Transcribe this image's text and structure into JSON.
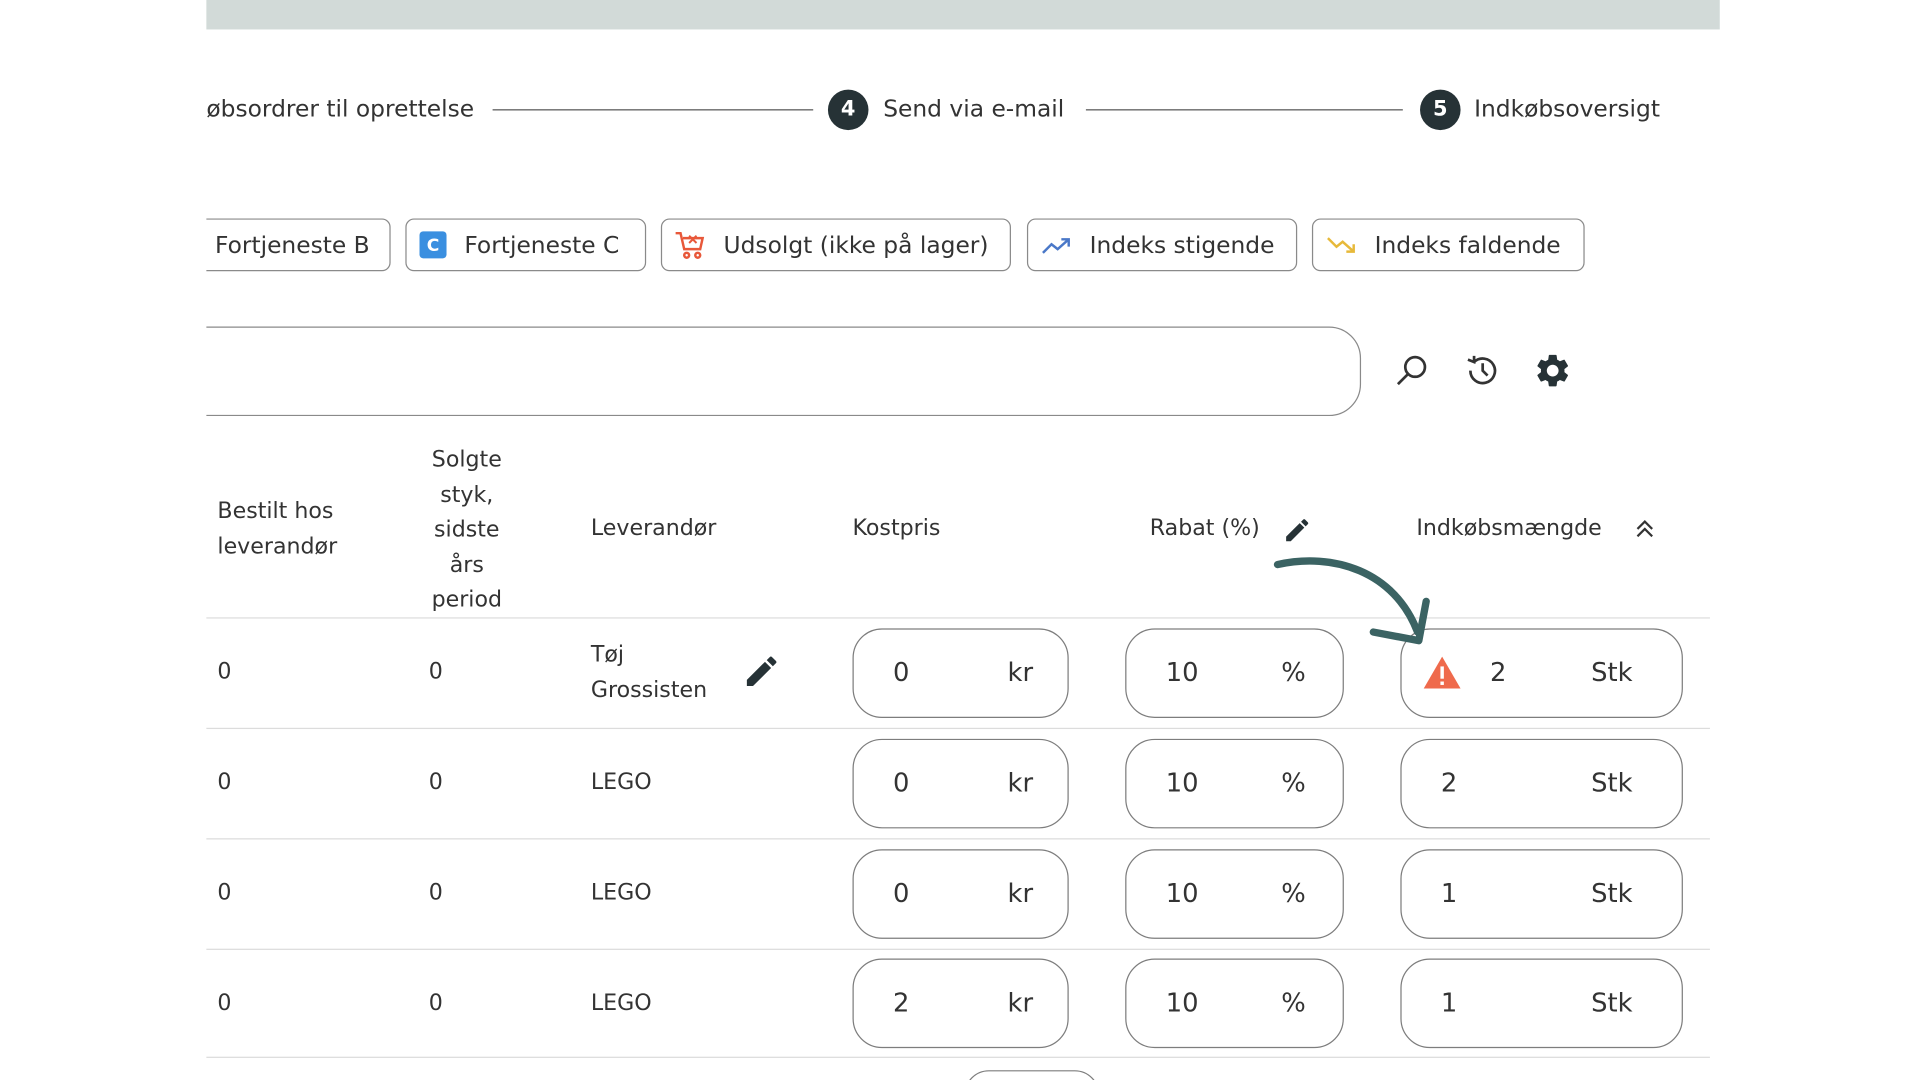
{
  "stepper": {
    "step3_label": "øbsordrer til oprettelse",
    "step4_number": "4",
    "step4_label": "Send via e-mail",
    "step5_number": "5",
    "step5_label": "Indkøbsoversigt"
  },
  "filters": {
    "chips": [
      {
        "label": "Fortjeneste B",
        "icon": "profit-b-icon"
      },
      {
        "label": "Fortjeneste C",
        "icon": "profit-c-icon",
        "badge": "C",
        "color": "#3a8fe0"
      },
      {
        "label": "Udsolgt (ikke på lager)",
        "icon": "cart-icon",
        "color": "#e8583a"
      },
      {
        "label": "Indeks stigende",
        "icon": "trend-up-icon",
        "color": "#4a78c8"
      },
      {
        "label": "Indeks faldende",
        "icon": "trend-down-icon",
        "color": "#e7b93a"
      }
    ]
  },
  "search": {
    "value": "",
    "icons": [
      "search-icon",
      "history-icon",
      "gear-icon"
    ]
  },
  "table": {
    "columns": {
      "ordered": [
        "Bestilt hos",
        "leverandør"
      ],
      "sold": [
        "Solgte",
        "styk,",
        "sidste",
        "års",
        "period"
      ],
      "supplier": "Leverandør",
      "cost": "Kostpris",
      "discount": "Rabat (%)",
      "quantity": "Indkøbsmængde"
    },
    "rows": [
      {
        "ordered": "0",
        "sold": "0",
        "supplier": [
          "Tøj",
          "Grossisten"
        ],
        "cost": "0",
        "cost_unit": "kr",
        "discount": "10",
        "discount_unit": "%",
        "quantity": "2",
        "quantity_unit": "Stk",
        "warning": true
      },
      {
        "ordered": "0",
        "sold": "0",
        "supplier": [
          "LEGO"
        ],
        "cost": "0",
        "cost_unit": "kr",
        "discount": "10",
        "discount_unit": "%",
        "quantity": "2",
        "quantity_unit": "Stk",
        "warning": false
      },
      {
        "ordered": "0",
        "sold": "0",
        "supplier": [
          "LEGO"
        ],
        "cost": "0",
        "cost_unit": "kr",
        "discount": "10",
        "discount_unit": "%",
        "quantity": "1",
        "quantity_unit": "Stk",
        "warning": false
      },
      {
        "ordered": "0",
        "sold": "0",
        "supplier": [
          "LEGO"
        ],
        "cost": "2",
        "cost_unit": "kr",
        "discount": "10",
        "discount_unit": "%",
        "quantity": "1",
        "quantity_unit": "Stk",
        "warning": false
      }
    ]
  },
  "colors": {
    "step_circle": "#263236",
    "warning": "#ef6a4c",
    "annotation_arrow": "#3b6363",
    "topbar": "#d2dad8"
  }
}
